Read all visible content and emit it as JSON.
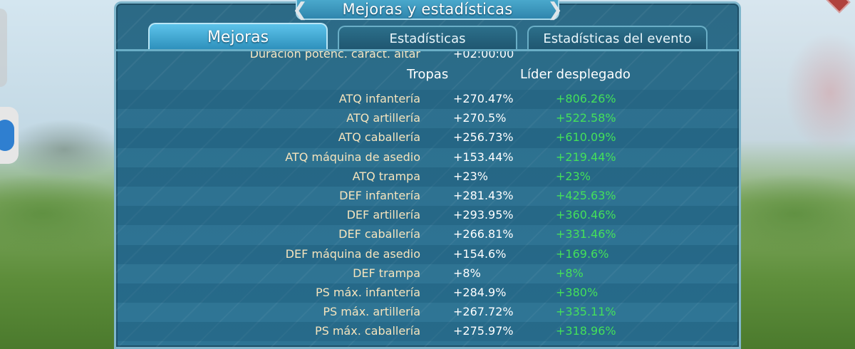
{
  "window": {
    "title": "Mejoras y estadísticas"
  },
  "tabs": [
    {
      "label": "Mejoras",
      "active": true
    },
    {
      "label": "Estadísticas",
      "active": false
    },
    {
      "label": "Estadísticas del evento",
      "active": false
    }
  ],
  "partial_row": {
    "label": "Duración potenc. caract. altar",
    "value": "+02:00:00"
  },
  "columns": {
    "troops": "Tropas",
    "leader": "Líder desplegado"
  },
  "stats": [
    {
      "label": "ATQ infantería",
      "troops": "+270.47%",
      "leader": "+806.26%"
    },
    {
      "label": "ATQ artillería",
      "troops": "+270.5%",
      "leader": "+522.58%"
    },
    {
      "label": "ATQ caballería",
      "troops": "+256.73%",
      "leader": "+610.09%"
    },
    {
      "label": "ATQ máquina de asedio",
      "troops": "+153.44%",
      "leader": "+219.44%"
    },
    {
      "label": "ATQ trampa",
      "troops": "+23%",
      "leader": "+23%"
    },
    {
      "label": "DEF infantería",
      "troops": "+281.43%",
      "leader": "+425.63%"
    },
    {
      "label": "DEF artillería",
      "troops": "+293.95%",
      "leader": "+360.46%"
    },
    {
      "label": "DEF caballería",
      "troops": "+266.81%",
      "leader": "+331.46%"
    },
    {
      "label": "DEF máquina de asedio",
      "troops": "+154.6%",
      "leader": "+169.6%"
    },
    {
      "label": "DEF trampa",
      "troops": "+8%",
      "leader": "+8%"
    },
    {
      "label": "PS máx. infantería",
      "troops": "+284.9%",
      "leader": "+380%"
    },
    {
      "label": "PS máx. artillería",
      "troops": "+267.72%",
      "leader": "+335.11%"
    },
    {
      "label": "PS máx. caballería",
      "troops": "+275.97%",
      "leader": "+318.96%"
    }
  ],
  "colors": {
    "panel_bg": "#2a6e8c",
    "label_text": "#f5e4bd",
    "troop_value": "#ffffff",
    "leader_value": "#44e05a",
    "tab_active": "#3aa6d4"
  },
  "icons": {
    "title_left": "chevron-left-icon",
    "title_right": "chevron-right-icon"
  }
}
